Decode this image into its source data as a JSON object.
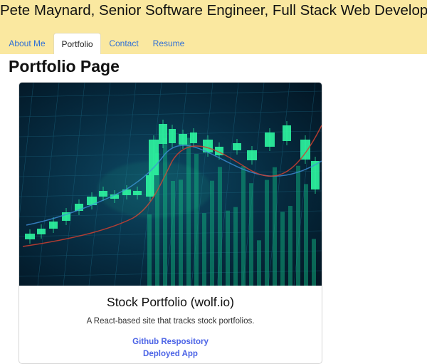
{
  "header": {
    "title": "Pete Maynard, Senior Software Engineer, Full Stack Web Developer",
    "tabs": [
      "About Me",
      "Portfolio",
      "Contact",
      "Resume"
    ],
    "active_tab": "Portfolio"
  },
  "page": {
    "title": "Portfolio Page"
  },
  "project": {
    "title": "Stock Portfolio (wolf.io)",
    "description": "A React-based site that tracks stock portfolios.",
    "links": [
      "Github Respository",
      "Deployed App"
    ]
  },
  "colors": {
    "header_bg": "#fae8a0",
    "link": "#4b63e6",
    "chart_glow": "#2ef5a0"
  }
}
